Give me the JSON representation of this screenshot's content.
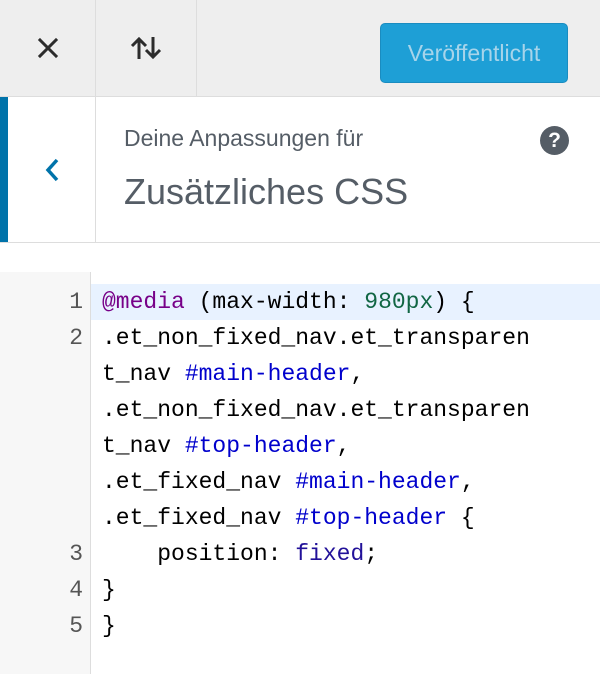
{
  "topbar": {
    "close_icon": "close-icon",
    "reorder_icon": "reorder-arrows-icon",
    "publish_label": "Veröffentlicht"
  },
  "section": {
    "back_icon": "chevron-left-icon",
    "subtitle": "Deine Anpassungen für",
    "title": "Zusätzliches CSS",
    "help_label": "?"
  },
  "editor": {
    "line_numbers": [
      "1",
      "2",
      "3",
      "4",
      "5"
    ],
    "lines": [
      {
        "number": "1",
        "text": "@media (max-width: 980px) {"
      },
      {
        "number": "2",
        "text": ".et_non_fixed_nav.et_transparent_nav #main-header, .et_non_fixed_nav.et_transparent_nav #top-header, .et_fixed_nav #main-header, .et_fixed_nav #top-header {"
      },
      {
        "number": "3",
        "text": "    position: fixed;"
      },
      {
        "number": "4",
        "text": "}"
      },
      {
        "number": "5",
        "text": "}"
      }
    ],
    "tokens": {
      "media": "@media",
      "media_open": " (max-width: ",
      "media_value": "980px",
      "media_close": ") {",
      "l2a": ".et_non_fixed_nav.et_transparen",
      "l2b": "t_nav ",
      "l2b_id": "#main-header",
      "l2b_end": ",",
      "l2c": ".et_non_fixed_nav.et_transparen",
      "l2d": "t_nav ",
      "l2d_id": "#top-header",
      "l2d_end": ",",
      "l2e": ".et_fixed_nav ",
      "l2e_id": "#main-header",
      "l2e_end": ",",
      "l2f": ".et_fixed_nav ",
      "l2f_id": "#top-header",
      "l2f_end": " {",
      "l3_indent": "    ",
      "l3_prop": "position: ",
      "l3_value": "fixed",
      "l3_end": ";",
      "l4": "}",
      "l5": "}"
    },
    "colors": {
      "keyword": "#770088",
      "number": "#116644",
      "id": "#0000cc",
      "atom": "#221199",
      "active_line": "#e8f2ff"
    }
  },
  "colors": {
    "accent": "#0073aa",
    "publish_bg": "#1e9fd6"
  }
}
